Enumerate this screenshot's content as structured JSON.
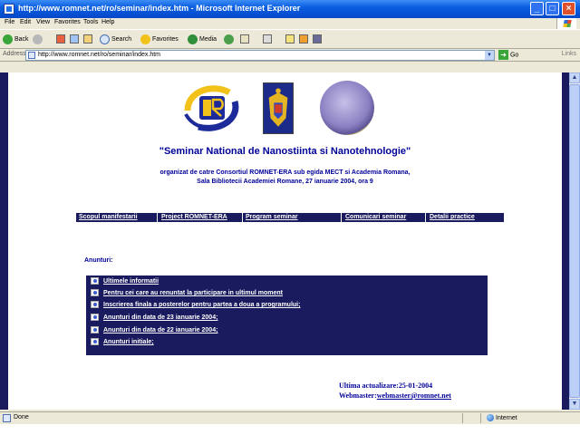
{
  "window": {
    "title": "http://www.romnet.net/ro/seminar/index.htm - Microsoft Internet Explorer"
  },
  "menu": [
    "File",
    "Edit",
    "View",
    "Favorites",
    "Tools",
    "Help"
  ],
  "toolbar": {
    "back": "Back",
    "search": "Search",
    "favorites": "Favorites",
    "media": "Media"
  },
  "address": {
    "label": "Address",
    "url": "http://www.romnet.net/ro/seminar/index.htm",
    "go": "Go",
    "links": "Links"
  },
  "page": {
    "title": "\"Seminar National de Nanostiinta si Nanotehnologie\"",
    "subtitle_line1": "organizat de catre Consortiul ROMNET-ERA sub egida  MECT si Academia Romana,",
    "subtitle_line2": "Sala Bibliotecii Academiei Romane, 27 ianuarie 2004, ora 9",
    "nav": [
      "Scopul manifestarii",
      "Project ROMNET-ERA",
      "Program seminar",
      "Comunicari seminar",
      "Detalii practice"
    ],
    "anunturi_heading": "Anunturi:",
    "news": [
      "Ultimele informatii",
      "Pentru cei care au renuntat la participare in ultimul moment",
      "Inscrierea finala a posterelor pentru partea a doua a programului;",
      "Anunturi din data de 23 ianuarie 2004;",
      "Anunturi din data de 22 ianuarie 2004;",
      "Anunturi initiale;"
    ],
    "last_update": "Ultima actualizare:25-01-2004",
    "webmaster_label": "Webmaster:",
    "webmaster_email": "webmaster@romnet.net"
  },
  "status": {
    "text": "Done",
    "zone": "Internet"
  },
  "colors": {
    "page_frame": "#1a1a5e",
    "heading_text": "#000099",
    "titlebar": "#0a5ee0"
  }
}
